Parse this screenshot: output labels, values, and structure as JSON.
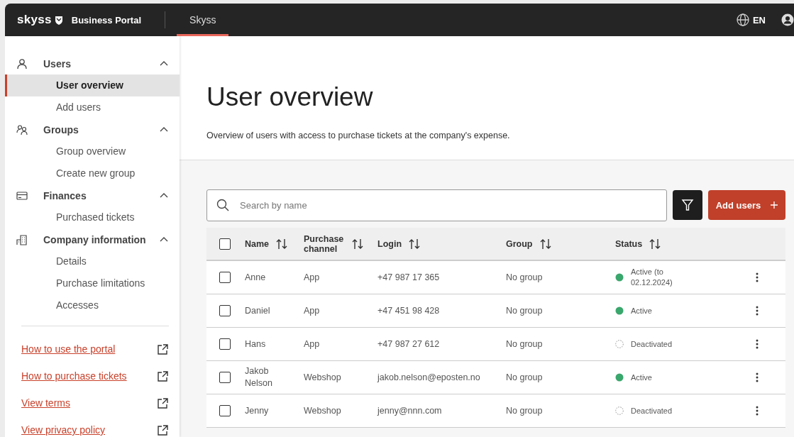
{
  "topbar": {
    "logo": "skyss",
    "product": "Business Portal",
    "tabs": [
      {
        "label": "Skyss",
        "selected": true
      }
    ],
    "language": "EN"
  },
  "sidebar": {
    "sections": [
      {
        "label": "Users",
        "expanded": true,
        "children": [
          {
            "label": "User overview",
            "selected": true
          },
          {
            "label": "Add users",
            "selected": false
          }
        ]
      },
      {
        "label": "Groups",
        "expanded": true,
        "children": [
          {
            "label": "Group overview",
            "selected": false
          },
          {
            "label": "Create new group",
            "selected": false
          }
        ]
      },
      {
        "label": "Finances",
        "expanded": true,
        "children": [
          {
            "label": "Purchased tickets",
            "selected": false
          }
        ]
      },
      {
        "label": "Company information",
        "expanded": true,
        "children": [
          {
            "label": "Details",
            "selected": false
          },
          {
            "label": "Purchase limitations",
            "selected": false
          },
          {
            "label": "Accesses",
            "selected": false
          }
        ]
      }
    ],
    "links": [
      "How to use the portal",
      "How to purchase tickets",
      "View terms",
      "View privacy policy"
    ]
  },
  "page": {
    "title": "User overview",
    "description": "Overview of users with access to purchase tickets at the company's expense."
  },
  "toolbar": {
    "search": {
      "placeholder": "Search by name"
    },
    "add_button": "Add users"
  },
  "table": {
    "all_checked": false,
    "columns": [
      "Name",
      "Purchase channel",
      "Login",
      "Group",
      "Status"
    ],
    "rows": [
      {
        "checked": false,
        "name": "Anne",
        "channel": "App",
        "login": "+47 987 17 365",
        "group": "No group",
        "status": {
          "kind": "active",
          "label": "Active (to 02.12.2024)"
        }
      },
      {
        "checked": false,
        "name": "Daniel",
        "channel": "App",
        "login": "+47 451 98 428",
        "group": "No group",
        "status": {
          "kind": "active",
          "label": "Active"
        }
      },
      {
        "checked": false,
        "name": "Hans",
        "channel": "App",
        "login": "+47 987 27 612",
        "group": "No group",
        "status": {
          "kind": "deactivated",
          "label": "Deactivated"
        }
      },
      {
        "checked": false,
        "name": "Jakob Nelson",
        "channel": "Webshop",
        "login": "jakob.nelson@eposten.no",
        "group": "No group",
        "status": {
          "kind": "active",
          "label": "Active"
        }
      },
      {
        "checked": false,
        "name": "Jenny",
        "channel": "Webshop",
        "login": "jenny@nnn.com",
        "group": "No group",
        "status": {
          "kind": "deactivated",
          "label": "Deactivated"
        }
      }
    ]
  }
}
